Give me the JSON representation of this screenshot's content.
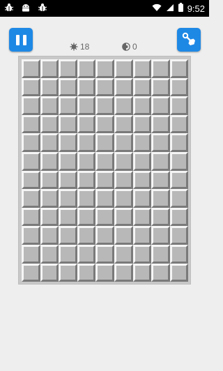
{
  "status_bar": {
    "left_icons": [
      "bug-icon",
      "android-icon",
      "bug-icon"
    ],
    "right_icons": [
      "wifi-icon",
      "signal-icon",
      "battery-icon"
    ],
    "time": "9:52"
  },
  "toolbar": {
    "pause_icon": "pause-icon",
    "shovel_icon": "shovel-icon"
  },
  "stats": {
    "mines_icon": "mine-icon",
    "mines_count": "18",
    "flags_icon": "flag-icon",
    "flags_count": "0"
  },
  "board": {
    "rows": 12,
    "cols": 9,
    "state": "all-covered"
  },
  "colors": {
    "accent": "#1e88e5",
    "background": "#eeeeee",
    "cell": "#b8b8b8"
  }
}
